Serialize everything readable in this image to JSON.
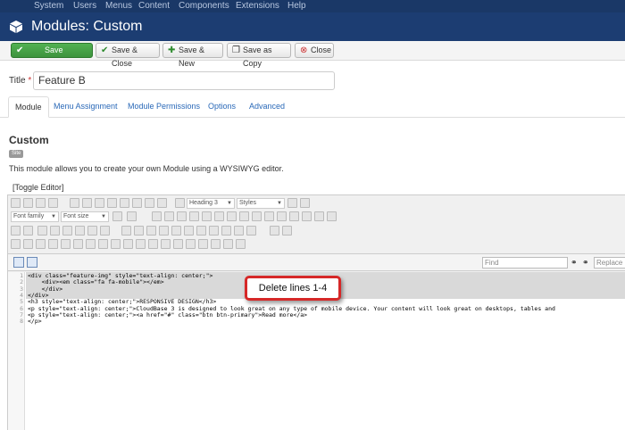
{
  "top_menu": [
    "System",
    "Users",
    "Menus",
    "Content",
    "Components",
    "Extensions",
    "Help"
  ],
  "header": {
    "title": "Modules: Custom",
    "icon": "cube-icon"
  },
  "toolbar": {
    "save": "Save",
    "save_close": "Save & Close",
    "save_new": "Save & New",
    "save_copy": "Save as Copy",
    "close": "Close"
  },
  "form": {
    "title_label": "Title",
    "title_required": "*",
    "title_value": "Feature B"
  },
  "tabs": [
    "Module",
    "Menu Assignment",
    "Module Permissions",
    "Options",
    "Advanced"
  ],
  "module": {
    "heading": "Custom",
    "badge": "Site",
    "description": "This module allows you to create your own Module using a WYSIWYG editor.",
    "toggle_editor": "[Toggle Editor]"
  },
  "editor_toolbar": {
    "format_select": "Heading 3",
    "styles_select": "Styles",
    "font_family": "Font family",
    "font_size": "Font size",
    "bold": "B",
    "italic": "I",
    "underline": "U",
    "strike": "S"
  },
  "code_toolbar": {
    "find_placeholder": "Find",
    "replace_placeholder": "Replace"
  },
  "code_lines": [
    {
      "n": "1",
      "text": "<div class=\"feature-img\" style=\"text-align: center;\">"
    },
    {
      "n": "2",
      "text": "    <div><em class=\"fa fa-mobile\"></em>"
    },
    {
      "n": "3",
      "text": "    </div>"
    },
    {
      "n": "4",
      "text": "</div>"
    },
    {
      "n": "5",
      "text": "<h3 style=\"text-align: center;\">RESPONSIVE DESIGN</h3>"
    },
    {
      "n": "6",
      "text": "<p style=\"text-align: center;\">CloudBase 3 is designed to look great on any type of mobile device. Your content will look great on desktops, tables and"
    },
    {
      "n": "7",
      "text": "<p style=\"text-align: center;\"><a href=\"#\" class=\"btn btn-primary\">Read more</a>"
    },
    {
      "n": "8",
      "text": "</p>"
    }
  ],
  "callout": "Delete lines 1-4"
}
